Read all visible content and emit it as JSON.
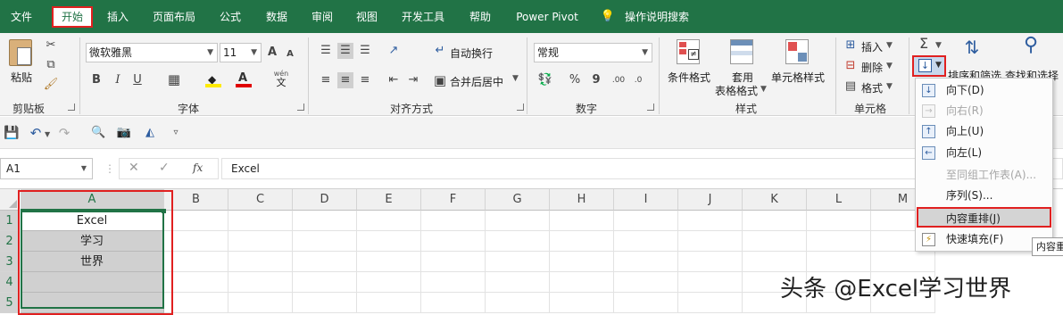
{
  "tabs": [
    "文件",
    "开始",
    "插入",
    "页面布局",
    "公式",
    "数据",
    "审阅",
    "视图",
    "开发工具",
    "帮助",
    "Power Pivot",
    "操作说明搜索"
  ],
  "ribbon": {
    "clipboard": {
      "paste": "粘贴",
      "group": "剪贴板"
    },
    "font": {
      "name": "微软雅黑",
      "size": "11",
      "bold": "B",
      "italic": "I",
      "underline": "U",
      "group": "字体",
      "grow": "A",
      "shrink": "A",
      "wen": "wén",
      "wen_char": "文",
      "fill_char": "A"
    },
    "alignment": {
      "wrap": "自动换行",
      "merge": "合并后居中",
      "group": "对齐方式"
    },
    "number": {
      "format": "常规",
      "percent": "%",
      "comma": "9",
      "group": "数字"
    },
    "styles": {
      "conditional": "条件格式",
      "table_format_1": "套用",
      "table_format_2": "表格格式",
      "cell_styles": "单元格样式",
      "group": "样式"
    },
    "cells": {
      "insert": "插入",
      "delete": "删除",
      "format": "格式",
      "group": "单元格"
    },
    "editing": {
      "sigma": "Σ",
      "sort": "排序和筛选",
      "find": "查找和选择"
    }
  },
  "formula_bar": {
    "name_box": "A1",
    "fx": "fx",
    "value": "Excel"
  },
  "columns": [
    "A",
    "B",
    "C",
    "D",
    "E",
    "F",
    "G",
    "H",
    "I",
    "J",
    "K",
    "L",
    "M"
  ],
  "rows": [
    "1",
    "2",
    "3",
    "4",
    "5"
  ],
  "cells": {
    "A1": "Excel",
    "A2": "学习",
    "A3": "世界"
  },
  "fill_menu": [
    {
      "label": "向下(D)",
      "icon": "arrow-down-icon",
      "disabled": false
    },
    {
      "label": "向右(R)",
      "icon": "arrow-right-icon",
      "disabled": true
    },
    {
      "label": "向上(U)",
      "icon": "arrow-up-icon",
      "disabled": false
    },
    {
      "label": "向左(L)",
      "icon": "arrow-left-icon",
      "disabled": false
    },
    {
      "label": "至同组工作表(A)...",
      "icon": "",
      "disabled": true
    },
    {
      "label": "序列(S)...",
      "icon": "",
      "disabled": false
    },
    {
      "label": "内容重排(J)",
      "icon": "",
      "disabled": false,
      "selected": true
    },
    {
      "label": "快速填充(F)",
      "icon": "flash-fill-icon",
      "disabled": false
    }
  ],
  "tooltip": "内容重",
  "watermark": "头条 @Excel学习世界",
  "colors": {
    "excel_green": "#217346",
    "highlight_red": "#e02020",
    "menu_selected": "#d4d4d4"
  }
}
